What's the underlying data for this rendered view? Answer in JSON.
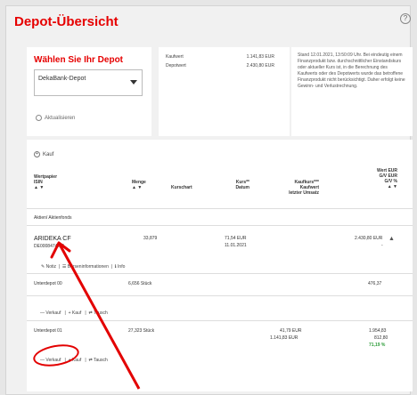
{
  "header": {
    "title": "Depot-Übersicht",
    "help": "?"
  },
  "depot": {
    "title": "Wählen Sie Ihr Depot",
    "selected": "DekaBank-Depot",
    "refresh": "Aktualisieren"
  },
  "summary": {
    "rows": [
      {
        "label": "Kaufwert",
        "value": "1.141,83 EUR"
      },
      {
        "label": "Depotwert",
        "value": "2.430,80 EUR"
      }
    ],
    "info": "Stand 12.01.2021, 13:50:09 Uhr. Bei eindeutig einem Finanzprodukt bzw. durchschnittlicher Einstandskurs oder aktueller Kurs ist, in die Berechnung des Kaufwerts oder des Depotwerts wurde das betroffene Finanzprodukt nicht berücksichtigt. Daher erfolgt keine Gewinn- und Verlustrechnung."
  },
  "table": {
    "kauf": "Kauf",
    "head": {
      "wertpapier": "Wertpapier",
      "isin": "ISIN",
      "menge": "Menge",
      "kurschart": "Kurschart",
      "kurs": "Kurs**",
      "datum": "Datum",
      "kaufkurs": "Kaufkurs***",
      "kaufwert": "Kaufwert",
      "letzter": "letzter Umsatz",
      "wert": "Wert EUR",
      "guv": "G/V EUR",
      "guvpct": "G/V %"
    },
    "section": "Aktien/ Aktienfonds",
    "position": {
      "name": "ARIDEKA CF",
      "isin": "DE0008474511",
      "menge": "33,879",
      "kurs": "71,54 EUR",
      "datum": "11.01.2021",
      "wert": "2.430,80 EUR",
      "guv": "-"
    },
    "tools": {
      "notiz": "Notiz",
      "boerse": "Börseninformationen",
      "info": "Info"
    },
    "unterdepots": [
      {
        "name": "Unterdepot 00",
        "stueck": "6,656 Stück",
        "kaufkurs": "",
        "kaufwert": "",
        "wert": "476,37",
        "guv": "",
        "guvpct": ""
      },
      {
        "name": "Unterdepot 01",
        "stueck": "27,323 Stück",
        "kaufkurs": "41,79 EUR",
        "kaufwert": "1.141,83 EUR",
        "wert": "1.954,83",
        "guv": "812,80",
        "guvpct": "71,19 %"
      }
    ],
    "actions": {
      "verkauf": "Verkauf",
      "kauf": "Kauf",
      "tausch": "Tausch"
    }
  },
  "colors": {
    "brand": "#e60000",
    "annotation": "#e30000",
    "positive": "#2e9d3a"
  }
}
